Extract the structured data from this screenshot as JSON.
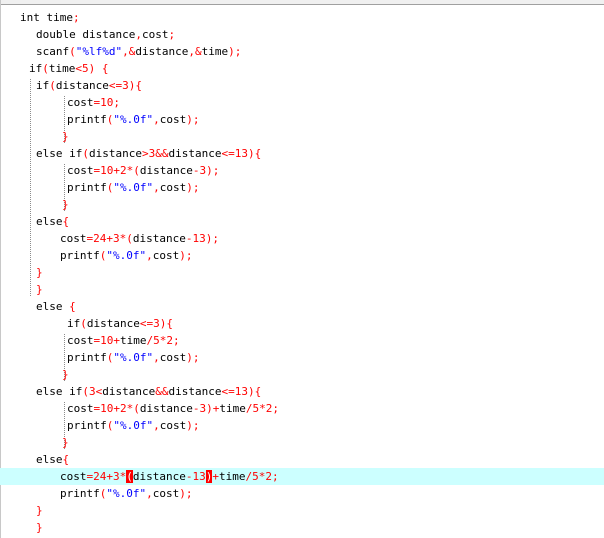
{
  "editor": {
    "lines": [
      {
        "indent": 20,
        "current": false,
        "tokens": [
          {
            "t": "int",
            "c": "kw"
          },
          {
            "t": " time",
            "c": "id"
          },
          {
            "t": ";",
            "c": "op"
          }
        ]
      },
      {
        "indent": 36,
        "current": false,
        "tokens": [
          {
            "t": "double",
            "c": "kw"
          },
          {
            "t": " distance",
            "c": "id"
          },
          {
            "t": ",",
            "c": "op"
          },
          {
            "t": "cost",
            "c": "id"
          },
          {
            "t": ";",
            "c": "op"
          }
        ]
      },
      {
        "indent": 36,
        "current": false,
        "tokens": [
          {
            "t": "scanf",
            "c": "id"
          },
          {
            "t": "(",
            "c": "op"
          },
          {
            "t": "\"%lf%d\"",
            "c": "str"
          },
          {
            "t": ",&",
            "c": "op"
          },
          {
            "t": "distance",
            "c": "id"
          },
          {
            "t": ",&",
            "c": "op"
          },
          {
            "t": "time",
            "c": "id"
          },
          {
            "t": ");",
            "c": "op"
          }
        ]
      },
      {
        "indent": 29,
        "current": false,
        "tokens": [
          {
            "t": "if",
            "c": "kw"
          },
          {
            "t": "(",
            "c": "op"
          },
          {
            "t": "time",
            "c": "id"
          },
          {
            "t": "<",
            "c": "op"
          },
          {
            "t": "5",
            "c": "num"
          },
          {
            "t": ") {",
            "c": "op"
          }
        ]
      },
      {
        "indent": 36,
        "current": false,
        "tokens": [
          {
            "t": "if",
            "c": "kw"
          },
          {
            "t": "(",
            "c": "op"
          },
          {
            "t": "distance",
            "c": "id"
          },
          {
            "t": "<=",
            "c": "op"
          },
          {
            "t": "3",
            "c": "num"
          },
          {
            "t": "){",
            "c": "op"
          }
        ]
      },
      {
        "indent": 67,
        "current": false,
        "tokens": [
          {
            "t": "cost",
            "c": "id"
          },
          {
            "t": "=",
            "c": "op"
          },
          {
            "t": "10",
            "c": "num"
          },
          {
            "t": ";",
            "c": "op"
          }
        ]
      },
      {
        "indent": 67,
        "current": false,
        "tokens": [
          {
            "t": "printf",
            "c": "id"
          },
          {
            "t": "(",
            "c": "op"
          },
          {
            "t": "\"%.0f\"",
            "c": "str"
          },
          {
            "t": ",",
            "c": "op"
          },
          {
            "t": "cost",
            "c": "id"
          },
          {
            "t": ");",
            "c": "op"
          }
        ]
      },
      {
        "indent": 62,
        "current": false,
        "tokens": [
          {
            "t": "}",
            "c": "op"
          }
        ]
      },
      {
        "indent": 36,
        "current": false,
        "tokens": [
          {
            "t": "else if",
            "c": "kw"
          },
          {
            "t": "(",
            "c": "op"
          },
          {
            "t": "distance",
            "c": "id"
          },
          {
            "t": ">",
            "c": "op"
          },
          {
            "t": "3",
            "c": "num"
          },
          {
            "t": "&&",
            "c": "op"
          },
          {
            "t": "distance",
            "c": "id"
          },
          {
            "t": "<=",
            "c": "op"
          },
          {
            "t": "13",
            "c": "num"
          },
          {
            "t": "){",
            "c": "op"
          }
        ]
      },
      {
        "indent": 67,
        "current": false,
        "tokens": [
          {
            "t": "cost",
            "c": "id"
          },
          {
            "t": "=",
            "c": "op"
          },
          {
            "t": "10",
            "c": "num"
          },
          {
            "t": "+",
            "c": "op"
          },
          {
            "t": "2",
            "c": "num"
          },
          {
            "t": "*(",
            "c": "op"
          },
          {
            "t": "distance",
            "c": "id"
          },
          {
            "t": "-",
            "c": "op"
          },
          {
            "t": "3",
            "c": "num"
          },
          {
            "t": ");",
            "c": "op"
          }
        ]
      },
      {
        "indent": 67,
        "current": false,
        "tokens": [
          {
            "t": "printf",
            "c": "id"
          },
          {
            "t": "(",
            "c": "op"
          },
          {
            "t": "\"%.0f\"",
            "c": "str"
          },
          {
            "t": ",",
            "c": "op"
          },
          {
            "t": "cost",
            "c": "id"
          },
          {
            "t": ");",
            "c": "op"
          }
        ]
      },
      {
        "indent": 62,
        "current": false,
        "tokens": [
          {
            "t": "}",
            "c": "op"
          }
        ]
      },
      {
        "indent": 36,
        "current": false,
        "tokens": [
          {
            "t": "else",
            "c": "kw"
          },
          {
            "t": "{",
            "c": "op"
          }
        ]
      },
      {
        "indent": 60,
        "current": false,
        "tokens": [
          {
            "t": "cost",
            "c": "id"
          },
          {
            "t": "=",
            "c": "op"
          },
          {
            "t": "24",
            "c": "num"
          },
          {
            "t": "+",
            "c": "op"
          },
          {
            "t": "3",
            "c": "num"
          },
          {
            "t": "*(",
            "c": "op"
          },
          {
            "t": "distance",
            "c": "id"
          },
          {
            "t": "-",
            "c": "op"
          },
          {
            "t": "13",
            "c": "num"
          },
          {
            "t": ");",
            "c": "op"
          }
        ]
      },
      {
        "indent": 60,
        "current": false,
        "tokens": [
          {
            "t": "printf",
            "c": "id"
          },
          {
            "t": "(",
            "c": "op"
          },
          {
            "t": "\"%.0f\"",
            "c": "str"
          },
          {
            "t": ",",
            "c": "op"
          },
          {
            "t": "cost",
            "c": "id"
          },
          {
            "t": ");",
            "c": "op"
          }
        ]
      },
      {
        "indent": 36,
        "current": false,
        "tokens": [
          {
            "t": "}",
            "c": "op"
          }
        ]
      },
      {
        "indent": 36,
        "current": false,
        "tokens": [
          {
            "t": "}",
            "c": "op"
          }
        ]
      },
      {
        "indent": 36,
        "current": false,
        "tokens": [
          {
            "t": "else",
            "c": "kw"
          },
          {
            "t": " {",
            "c": "op"
          }
        ]
      },
      {
        "indent": 67,
        "current": false,
        "tokens": [
          {
            "t": "if",
            "c": "kw"
          },
          {
            "t": "(",
            "c": "op"
          },
          {
            "t": "distance",
            "c": "id"
          },
          {
            "t": "<=",
            "c": "op"
          },
          {
            "t": "3",
            "c": "num"
          },
          {
            "t": "){",
            "c": "op"
          }
        ]
      },
      {
        "indent": 67,
        "current": false,
        "tokens": [
          {
            "t": "cost",
            "c": "id"
          },
          {
            "t": "=",
            "c": "op"
          },
          {
            "t": "10",
            "c": "num"
          },
          {
            "t": "+",
            "c": "op"
          },
          {
            "t": "time",
            "c": "id"
          },
          {
            "t": "/",
            "c": "op"
          },
          {
            "t": "5",
            "c": "num"
          },
          {
            "t": "*",
            "c": "op"
          },
          {
            "t": "2",
            "c": "num"
          },
          {
            "t": ";",
            "c": "op"
          }
        ]
      },
      {
        "indent": 67,
        "current": false,
        "tokens": [
          {
            "t": "printf",
            "c": "id"
          },
          {
            "t": "(",
            "c": "op"
          },
          {
            "t": "\"%.0f\"",
            "c": "str"
          },
          {
            "t": ",",
            "c": "op"
          },
          {
            "t": "cost",
            "c": "id"
          },
          {
            "t": ");",
            "c": "op"
          }
        ]
      },
      {
        "indent": 62,
        "current": false,
        "tokens": [
          {
            "t": "}",
            "c": "op"
          }
        ]
      },
      {
        "indent": 36,
        "current": false,
        "tokens": [
          {
            "t": "else if",
            "c": "kw"
          },
          {
            "t": "(",
            "c": "op"
          },
          {
            "t": "3",
            "c": "num"
          },
          {
            "t": "<",
            "c": "op"
          },
          {
            "t": "distance",
            "c": "id"
          },
          {
            "t": "&&",
            "c": "op"
          },
          {
            "t": "distance",
            "c": "id"
          },
          {
            "t": "<=",
            "c": "op"
          },
          {
            "t": "13",
            "c": "num"
          },
          {
            "t": "){",
            "c": "op"
          }
        ]
      },
      {
        "indent": 67,
        "current": false,
        "tokens": [
          {
            "t": "cost",
            "c": "id"
          },
          {
            "t": "=",
            "c": "op"
          },
          {
            "t": "10",
            "c": "num"
          },
          {
            "t": "+",
            "c": "op"
          },
          {
            "t": "2",
            "c": "num"
          },
          {
            "t": "*(",
            "c": "op"
          },
          {
            "t": "distance",
            "c": "id"
          },
          {
            "t": "-",
            "c": "op"
          },
          {
            "t": "3",
            "c": "num"
          },
          {
            "t": ")+",
            "c": "op"
          },
          {
            "t": "time",
            "c": "id"
          },
          {
            "t": "/",
            "c": "op"
          },
          {
            "t": "5",
            "c": "num"
          },
          {
            "t": "*",
            "c": "op"
          },
          {
            "t": "2",
            "c": "num"
          },
          {
            "t": ";",
            "c": "op"
          }
        ]
      },
      {
        "indent": 67,
        "current": false,
        "tokens": [
          {
            "t": "printf",
            "c": "id"
          },
          {
            "t": "(",
            "c": "op"
          },
          {
            "t": "\"%.0f\"",
            "c": "str"
          },
          {
            "t": ",",
            "c": "op"
          },
          {
            "t": "cost",
            "c": "id"
          },
          {
            "t": ");",
            "c": "op"
          }
        ]
      },
      {
        "indent": 62,
        "current": false,
        "tokens": [
          {
            "t": "}",
            "c": "op"
          }
        ]
      },
      {
        "indent": 36,
        "current": false,
        "tokens": [
          {
            "t": "else",
            "c": "kw"
          },
          {
            "t": "{",
            "c": "op"
          }
        ]
      },
      {
        "indent": 60,
        "current": true,
        "tokens": [
          {
            "t": "cost",
            "c": "id"
          },
          {
            "t": "=",
            "c": "op"
          },
          {
            "t": "24",
            "c": "num"
          },
          {
            "t": "+",
            "c": "op"
          },
          {
            "t": "3",
            "c": "num"
          },
          {
            "t": "*",
            "c": "op"
          },
          {
            "t": "(",
            "c": "hl"
          },
          {
            "t": "distance",
            "c": "id"
          },
          {
            "t": "-",
            "c": "op"
          },
          {
            "t": "13",
            "c": "num"
          },
          {
            "t": ")",
            "c": "hl"
          },
          {
            "t": "+",
            "c": "op"
          },
          {
            "t": "time",
            "c": "id"
          },
          {
            "t": "/",
            "c": "op"
          },
          {
            "t": "5",
            "c": "num"
          },
          {
            "t": "*",
            "c": "op"
          },
          {
            "t": "2",
            "c": "num"
          },
          {
            "t": ";",
            "c": "op"
          }
        ]
      },
      {
        "indent": 60,
        "current": false,
        "tokens": [
          {
            "t": "printf",
            "c": "id"
          },
          {
            "t": "(",
            "c": "op"
          },
          {
            "t": "\"%.0f\"",
            "c": "str"
          },
          {
            "t": ",",
            "c": "op"
          },
          {
            "t": "cost",
            "c": "id"
          },
          {
            "t": ");",
            "c": "op"
          }
        ]
      },
      {
        "indent": 36,
        "current": false,
        "tokens": [
          {
            "t": "}",
            "c": "op"
          }
        ]
      },
      {
        "indent": 36,
        "current": false,
        "tokens": [
          {
            "t": "}",
            "c": "op"
          }
        ]
      }
    ],
    "colors": {
      "keyword": "#000000",
      "operator": "#ff0000",
      "string": "#0000ff",
      "current_line": "#ccffff",
      "brace_match": "#ff0000"
    }
  }
}
